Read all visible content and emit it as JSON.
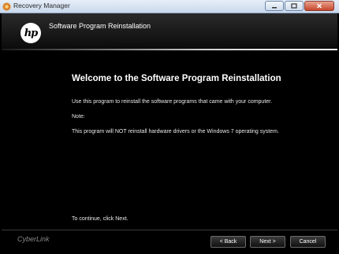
{
  "window": {
    "title": "Recovery Manager"
  },
  "header": {
    "logo_text": "hp",
    "title": "Software Program Reinstallation"
  },
  "content": {
    "heading": "Welcome to the Software Program Reinstallation",
    "line1": "Use this program to reinstall the software programs that came with your computer.",
    "line2": "Note:",
    "line3": "This program will NOT reinstall hardware drivers or the Windows 7 operating system.",
    "continue": "To continue, click Next."
  },
  "footer": {
    "brand": "CyberLink",
    "back_label": "< Back",
    "next_label": "Next >",
    "cancel_label": "Cancel"
  }
}
